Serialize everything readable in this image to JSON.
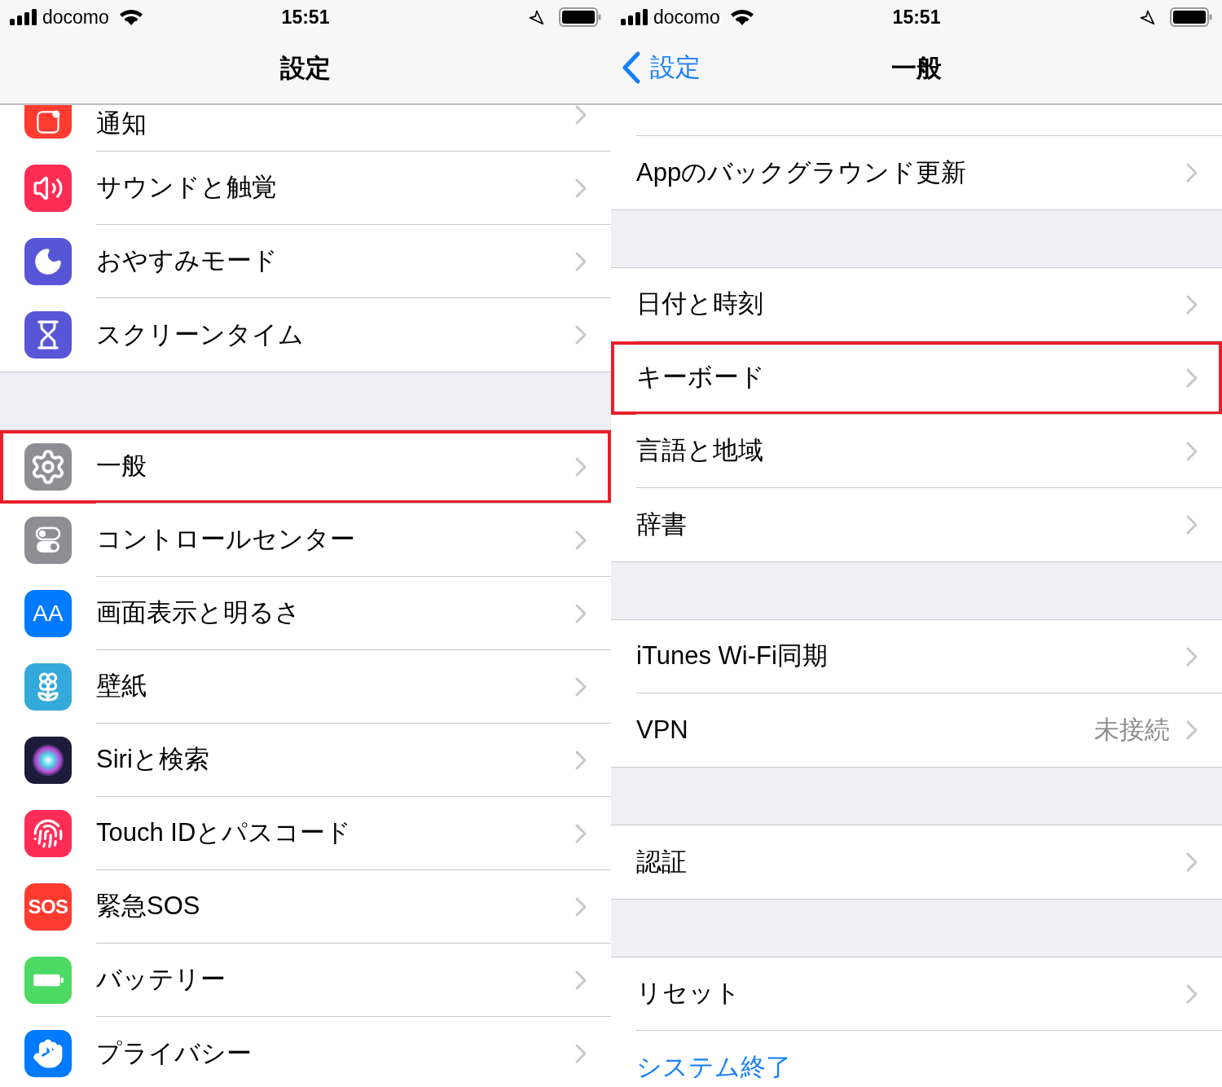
{
  "panels": [
    {
      "status_bar": {
        "carrier": "docomo",
        "time": "15:51"
      },
      "nav": {
        "title": "設定"
      },
      "sections": [
        {
          "rows": [
            {
              "kind": "icon",
              "label": "通知",
              "color": "#ff3b30",
              "cut": true,
              "highlighted": false
            },
            {
              "kind": "icon",
              "label": "サウンドと触覚",
              "color": "#ff2d55",
              "highlighted": false
            },
            {
              "kind": "icon",
              "label": "おやすみモード",
              "color": "#5856d6",
              "highlighted": false
            },
            {
              "kind": "icon",
              "label": "スクリーンタイム",
              "color": "#5856d6",
              "highlighted": false
            }
          ]
        },
        {
          "rows": [
            {
              "kind": "icon",
              "label": "一般",
              "color": "#8e8e93",
              "highlighted": true
            },
            {
              "kind": "icon",
              "label": "コントロールセンター",
              "color": "#8e8e93",
              "highlighted": false
            },
            {
              "kind": "icon",
              "label": "画面表示と明るさ",
              "color": "#007aff",
              "icon_text": "AA",
              "highlighted": false
            },
            {
              "kind": "icon",
              "label": "壁紙",
              "color": "#34aadc",
              "highlighted": false
            },
            {
              "kind": "icon",
              "label": "Siriと検索",
              "color": "#1c1c3a",
              "highlighted": false
            },
            {
              "kind": "icon",
              "label": "Touch IDとパスコード",
              "color": "#ff2d55",
              "highlighted": false
            },
            {
              "kind": "icon",
              "label": "緊急SOS",
              "color": "#ff3b30",
              "icon_text": "SOS",
              "highlighted": false
            },
            {
              "kind": "icon",
              "label": "バッテリー",
              "color": "#4cd964",
              "highlighted": false
            },
            {
              "kind": "icon",
              "label": "プライバシー",
              "color": "#007aff",
              "highlighted": false
            }
          ]
        }
      ]
    },
    {
      "status_bar": {
        "carrier": "docomo",
        "time": "15:51"
      },
      "nav": {
        "back": "設定",
        "title": "一般"
      },
      "sections": [
        {
          "rows": [
            {
              "kind": "plain",
              "cut": true,
              "highlighted": false
            },
            {
              "kind": "plain",
              "label": "Appのバックグラウンド更新",
              "highlighted": false
            }
          ]
        },
        {
          "rows": [
            {
              "kind": "plain",
              "label": "日付と時刻",
              "highlighted": false
            },
            {
              "kind": "plain",
              "label": "キーボード",
              "highlighted": true
            },
            {
              "kind": "plain",
              "label": "言語と地域",
              "highlighted": false
            },
            {
              "kind": "plain",
              "label": "辞書",
              "highlighted": false
            }
          ]
        },
        {
          "rows": [
            {
              "kind": "plain",
              "label": "iTunes Wi-Fi同期",
              "highlighted": false
            },
            {
              "kind": "plain",
              "label": "VPN",
              "value": "未接続",
              "highlighted": false
            }
          ]
        },
        {
          "rows": [
            {
              "kind": "plain",
              "label": "認証",
              "highlighted": false
            }
          ]
        },
        {
          "rows": [
            {
              "kind": "plain",
              "label": "リセット",
              "highlighted": false
            },
            {
              "kind": "action",
              "label": "システム終了",
              "highlighted": false
            }
          ]
        }
      ]
    }
  ]
}
